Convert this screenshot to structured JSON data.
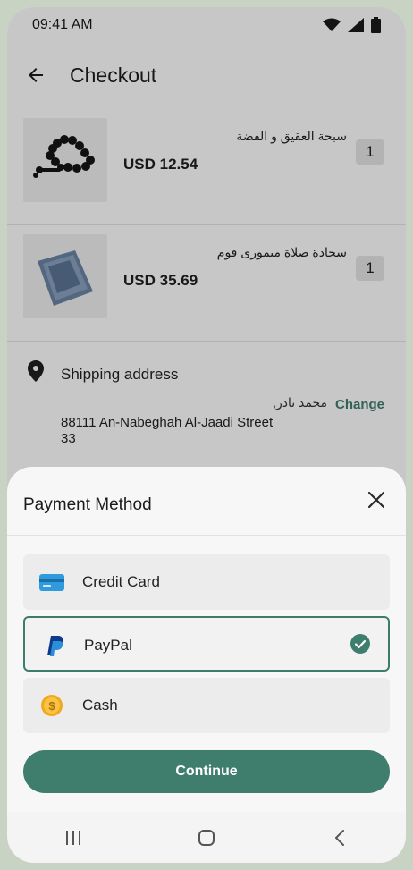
{
  "status_bar": {
    "time": "09:41 AM",
    "icons": [
      "wifi-icon",
      "cell-signal-icon",
      "battery-icon"
    ]
  },
  "app_bar": {
    "title": "Checkout",
    "back_icon": "arrow-left-icon"
  },
  "cart": {
    "items": [
      {
        "name": "سبحة العقيق و الفضة",
        "price": "USD 12.54",
        "quantity": "1",
        "image": "prayer-beads"
      },
      {
        "name": "سجادة صلاة ميمورى فوم",
        "price": "USD 35.69",
        "quantity": "1",
        "image": "prayer-rug"
      }
    ]
  },
  "shipping": {
    "title": "Shipping address",
    "recipient": "محمد نادر,",
    "change_label": "Change",
    "address_line1": "88111 An-Nabeghah Al-Jaadi Street",
    "address_line2": "33",
    "icon": "location-pin-icon"
  },
  "payment_sheet": {
    "title": "Payment Method",
    "close_icon": "close-icon",
    "options": [
      {
        "label": "Credit Card",
        "icon": "credit-card-icon",
        "selected": false
      },
      {
        "label": "PayPal",
        "icon": "paypal-icon",
        "selected": true
      },
      {
        "label": "Cash",
        "icon": "coin-icon",
        "selected": false
      }
    ],
    "continue_label": "Continue"
  },
  "nav_bar": {
    "buttons": [
      "recent-apps-icon",
      "home-icon",
      "back-icon"
    ]
  },
  "colors": {
    "accent": "#3f7d6d",
    "sheet_bg": "#f7f7f7",
    "option_bg": "#ececec"
  }
}
